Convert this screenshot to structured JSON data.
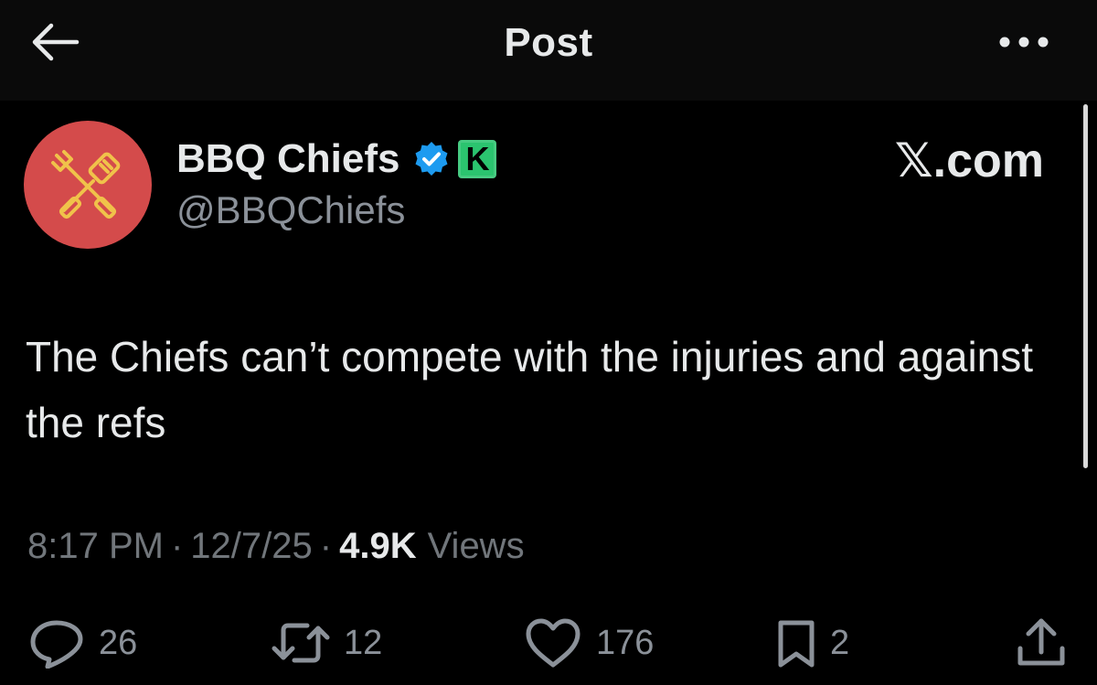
{
  "header": {
    "title": "Post",
    "back_icon": "arrow-left-icon",
    "more_icon": "more-horizontal-icon"
  },
  "post": {
    "author": {
      "display_name": "BBQ Chiefs",
      "handle": "@BBQChiefs",
      "avatar_icon": "crossed-fork-spatula-icon",
      "avatar_color": "#d44b4b",
      "verified_icon": "verified-badge-icon",
      "verified_color": "#1d9bf0",
      "affiliate_badge": "K",
      "affiliate_badge_color": "#2bc46f"
    },
    "source_label": "𝕏.com",
    "text": "The Chiefs can’t compete with the injuries and against the refs",
    "time": "8:17 PM",
    "date": "12/7/25",
    "separator": "·",
    "views_count": "4.9K",
    "views_label": "Views"
  },
  "actions": {
    "replies": "26",
    "reposts": "12",
    "likes": "176",
    "bookmarks": "2"
  },
  "colors": {
    "background": "#000000",
    "text_primary": "#e7e9ea",
    "text_secondary": "#71767b"
  }
}
